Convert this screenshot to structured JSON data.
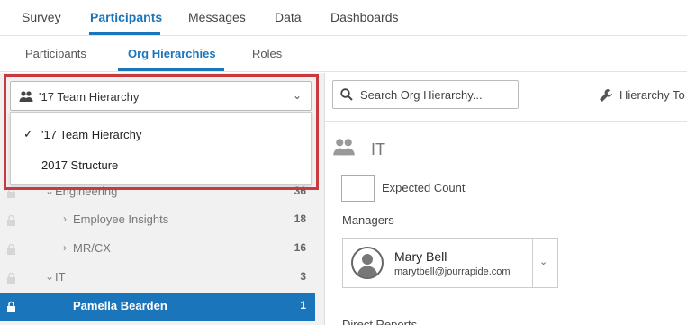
{
  "top_tabs": [
    {
      "label": "Survey"
    },
    {
      "label": "Participants"
    },
    {
      "label": "Messages"
    },
    {
      "label": "Data"
    },
    {
      "label": "Dashboards"
    }
  ],
  "sub_tabs": [
    {
      "label": "Participants"
    },
    {
      "label": "Org Hierarchies"
    },
    {
      "label": "Roles"
    }
  ],
  "hierarchy_select": {
    "value": "'17 Team Hierarchy",
    "options": [
      "'17 Team Hierarchy",
      "2017 Structure"
    ]
  },
  "search": {
    "placeholder": "Search Org Hierarchy..."
  },
  "tools": {
    "label": "Hierarchy To"
  },
  "tree": [
    {
      "label": "Engineering",
      "count": "36"
    },
    {
      "label": "Employee Insights",
      "count": "18"
    },
    {
      "label": "MR/CX",
      "count": "16"
    },
    {
      "label": "IT",
      "count": "3"
    },
    {
      "label": "Pamella Bearden",
      "count": "1"
    }
  ],
  "unit": {
    "title": "IT",
    "expected_count_label": "Expected Count",
    "managers_label": "Managers",
    "manager": {
      "name": "Mary Bell",
      "email": "marytbell@jourrapide.com"
    },
    "direct_reports_label": "Direct Reports"
  },
  "colors": {
    "accent": "#1b75bb",
    "highlight": "#c9393d",
    "panel_bg": "#f1f1f1"
  },
  "icons": [
    "group-icon",
    "search-icon",
    "wrench-icon",
    "lock-icon",
    "check-icon",
    "chevron-down-icon",
    "chevron-right-icon",
    "avatar-icon"
  ]
}
